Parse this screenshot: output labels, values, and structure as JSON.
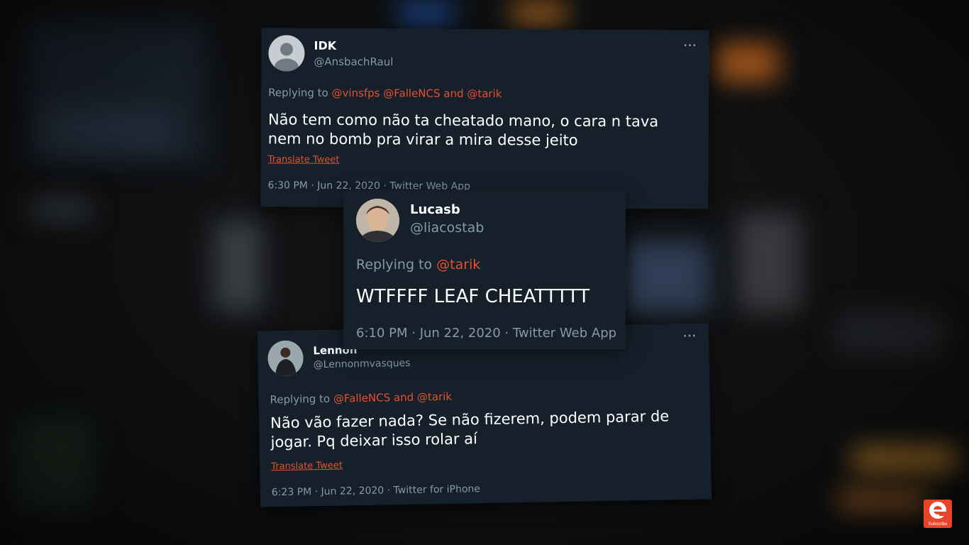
{
  "tweets": [
    {
      "name": "IDK",
      "handle": "@AnsbachRaul",
      "replying_prefix": "Replying to",
      "mentions": [
        "@vinsfps",
        "@FalleNCS",
        "and",
        "@tarik"
      ],
      "text": "Não tem como não ta cheatado mano, o cara n tava nem no bomb pra virar a mira desse jeito",
      "translate_label": "Translate Tweet",
      "meta": "6:30 PM · Jun 22, 2020 · Twitter Web App",
      "more_icon": "more-dots-icon"
    },
    {
      "name": "Lucasb",
      "handle": "@liacostab",
      "replying_prefix": "Replying to",
      "mentions": [
        "@tarik"
      ],
      "text": "WTFFFF LEAF CHEATTTTT",
      "meta": "6:10 PM · Jun 22, 2020 · Twitter Web App"
    },
    {
      "name": "Lennon",
      "handle": "@Lennonmvasques",
      "replying_prefix": "Replying to",
      "mentions": [
        "@FalleNCS",
        "and",
        "@tarik"
      ],
      "text": "Não vão fazer nada? Se não fizerem, podem parar de jogar. Pq deixar isso rolar aí",
      "translate_label": "Translate Tweet",
      "meta": "6:23 PM · Jun 22, 2020 · Twitter for iPhone",
      "more_icon": "more-dots-icon"
    }
  ],
  "subscribe": {
    "letter": "e",
    "label": "Subscribe"
  },
  "colors": {
    "card_bg": "#15202b",
    "mention": "#e8502d",
    "muted": "#8899a6",
    "brand": "#e8442a"
  }
}
